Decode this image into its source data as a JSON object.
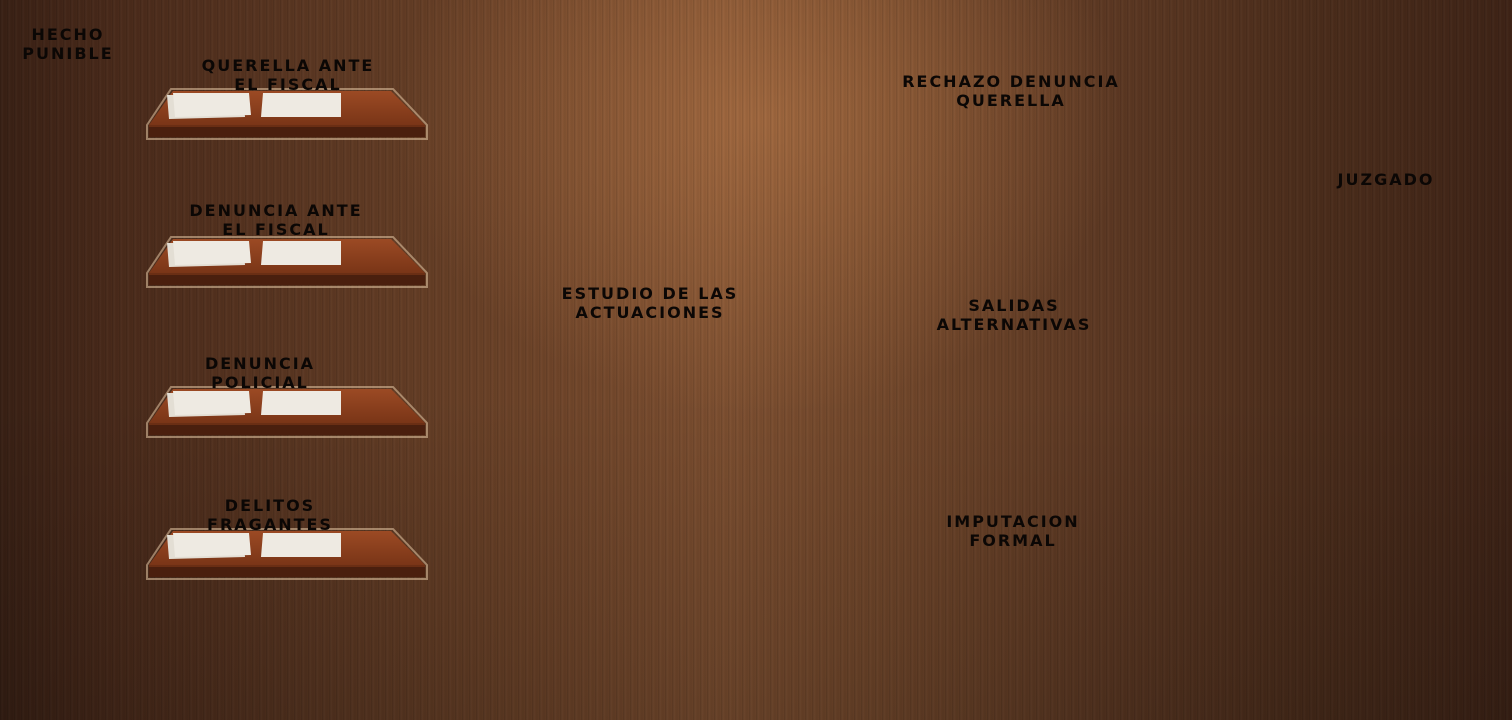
{
  "start_label": "HECHO\nPUNIBLE",
  "entries": [
    {
      "label": "QUERELLA ANTE\nEL FISCAL"
    },
    {
      "label": "DENUNCIA ANTE\nEL FISCAL"
    },
    {
      "label": "DENUNCIA\nPOLICIAL"
    },
    {
      "label": "DELITOS\nFRAGANTES"
    }
  ],
  "study_label": "ESTUDIO DE LAS\nACTUACIONES",
  "outcomes": [
    {
      "label": "RECHAZO DENUNCIA\nQUERELLA"
    },
    {
      "label": "SALIDAS\nALTERNATIVAS"
    },
    {
      "label": "IMPUTACION\nFORMAL"
    }
  ],
  "court_label": "JUZGADO",
  "colors": {
    "text": "#0b0705",
    "tray_top": "#8a3f1f",
    "tray_edge": "#4a1f0e",
    "paper": "#eeeae2"
  }
}
